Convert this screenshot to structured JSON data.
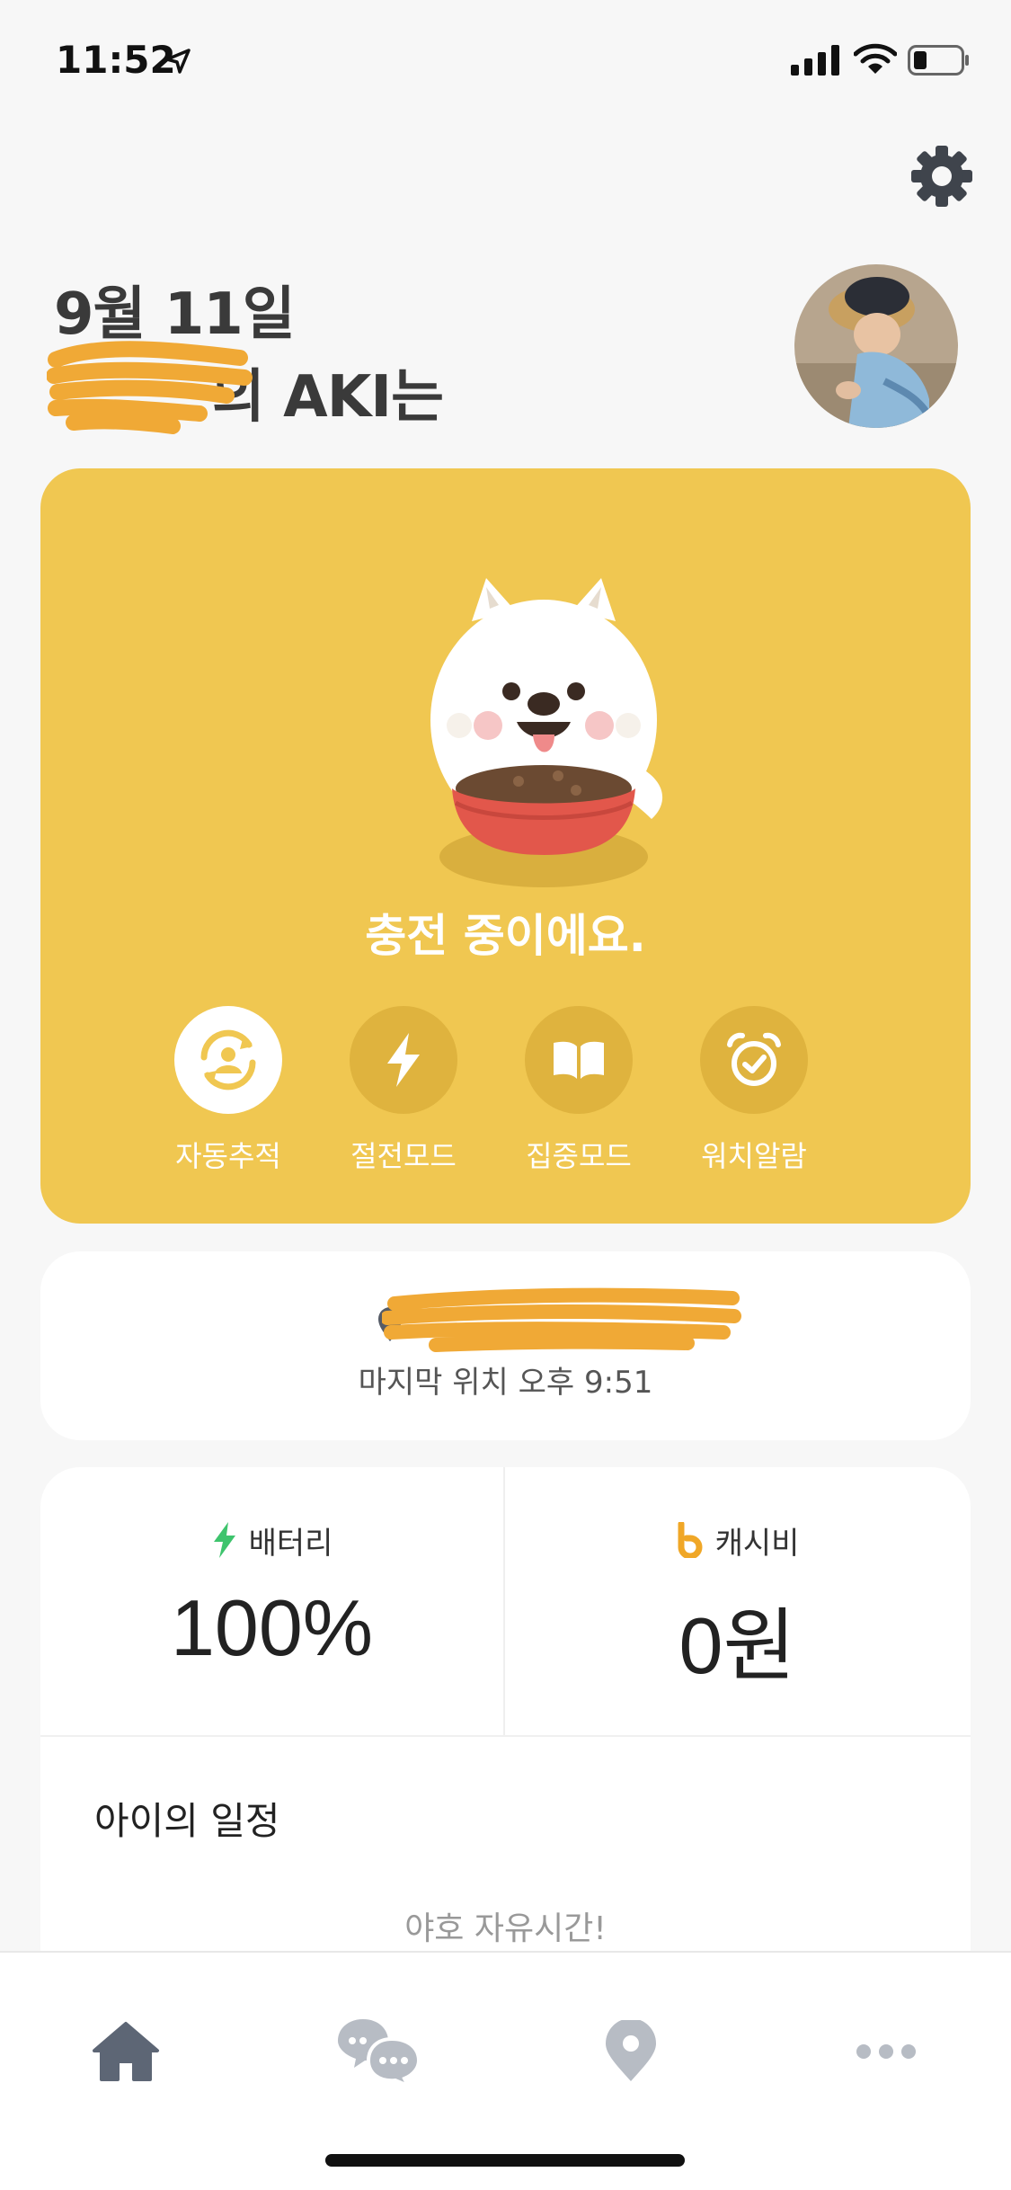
{
  "status_bar": {
    "time": "11:52"
  },
  "header": {
    "date": "9월 11일",
    "name_suffix": "의 AKI는"
  },
  "status_card": {
    "message": "충전 중이에요.",
    "modes": [
      {
        "label": "자동추적",
        "icon": "auto-track-icon",
        "active": true
      },
      {
        "label": "절전모드",
        "icon": "lightning-icon",
        "active": false
      },
      {
        "label": "집중모드",
        "icon": "book-icon",
        "active": false
      },
      {
        "label": "워치알람",
        "icon": "alarm-clock-icon",
        "active": false
      }
    ]
  },
  "location": {
    "last_seen": "마지막 위치 오후 9:51"
  },
  "stats": {
    "battery": {
      "label": "배터리",
      "value": "100%",
      "icon": "lightning-icon",
      "color": "#3ec46d"
    },
    "cash": {
      "label": "캐시비",
      "value": "0원",
      "icon": "cashbee-icon",
      "color": "#f0a727"
    }
  },
  "schedule": {
    "title": "아이의 일정",
    "empty_text": "야호 자유시간!"
  },
  "tab_bar": {
    "tabs": [
      {
        "icon": "home-icon",
        "active": true
      },
      {
        "icon": "chat-icon",
        "active": false
      },
      {
        "icon": "location-pin-icon",
        "active": false
      },
      {
        "icon": "more-icon",
        "active": false
      }
    ]
  },
  "colors": {
    "card_yellow": "#f0c751",
    "tab_active": "#5d6675",
    "tab_inactive": "#b7bcc4"
  }
}
